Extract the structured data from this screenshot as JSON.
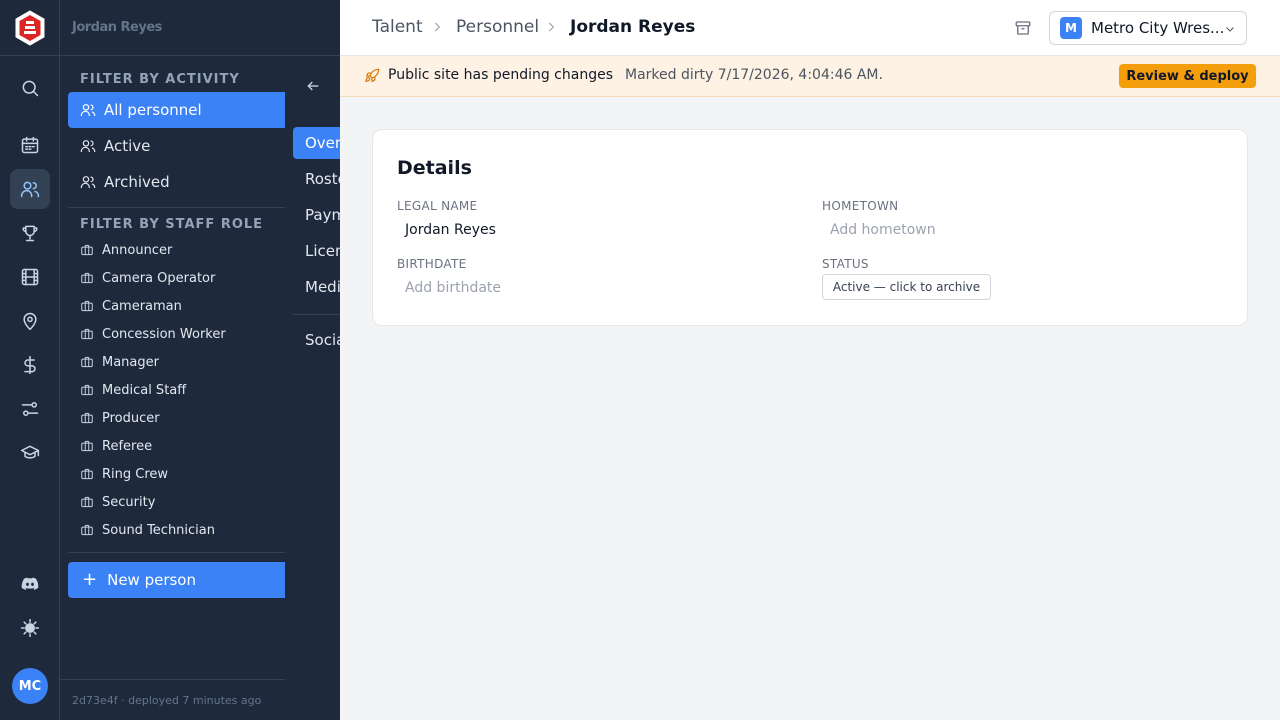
{
  "sidebar_rail": {
    "icons": [
      "logo-icon",
      "search-icon",
      "calendar-icon",
      "people-icon",
      "trophy-icon",
      "film-icon",
      "location-pin-icon",
      "dollar-icon",
      "sliders-icon",
      "graduation-cap-icon",
      "discord-icon",
      "settings-icon"
    ],
    "active": "people-icon",
    "avatar_initials": "MC"
  },
  "filter_panel": {
    "title": "Jordan Reyes",
    "activity_heading": "FILTER BY ACTIVITY",
    "activity_items": [
      {
        "label": "All personnel",
        "selected": true
      },
      {
        "label": "Active",
        "selected": false
      },
      {
        "label": "Archived",
        "selected": false
      }
    ],
    "role_heading": "FILTER BY STAFF ROLE",
    "roles": [
      {
        "label": "Announcer"
      },
      {
        "label": "Camera Operator"
      },
      {
        "label": "Cameraman"
      },
      {
        "label": "Concession Worker"
      },
      {
        "label": "Manager"
      },
      {
        "label": "Medical Staff"
      },
      {
        "label": "Producer"
      },
      {
        "label": "Referee"
      },
      {
        "label": "Ring Crew"
      },
      {
        "label": "Security"
      },
      {
        "label": "Sound Technician"
      }
    ],
    "new_button": "New person",
    "footer": "2d73e4f · deployed 7 minutes ago"
  },
  "subnav": {
    "items": [
      {
        "label": "Overview"
      },
      {
        "label": "Roster"
      },
      {
        "label": "Payments"
      },
      {
        "label": "Licenses"
      },
      {
        "label": "Media"
      },
      {
        "label": "Social"
      }
    ]
  },
  "header": {
    "breadcrumb": [
      "Talent",
      "Personnel",
      "Jordan Reyes"
    ],
    "org_badge": "M",
    "org_name": "Metro City Wres..."
  },
  "banner": {
    "title": "Public site has pending changes",
    "subtitle": "Marked dirty 7/17/2026, 4:04:46 AM.",
    "action": "Review & deploy"
  },
  "details": {
    "title": "Details",
    "legal_name_label": "LEGAL NAME",
    "legal_name_value": "Jordan Reyes",
    "hometown_label": "HOMETOWN",
    "hometown_placeholder": "Add hometown",
    "birthdate_label": "BIRTHDATE",
    "birthdate_placeholder": "Add birthdate",
    "status_label": "STATUS",
    "status_button": "Active — click to archive"
  },
  "colors": {
    "sidebar_bg": "#1e293b",
    "accent": "#3b82f6",
    "banner_bg": "#fdf2e3",
    "deploy_button": "#f59e0b"
  }
}
